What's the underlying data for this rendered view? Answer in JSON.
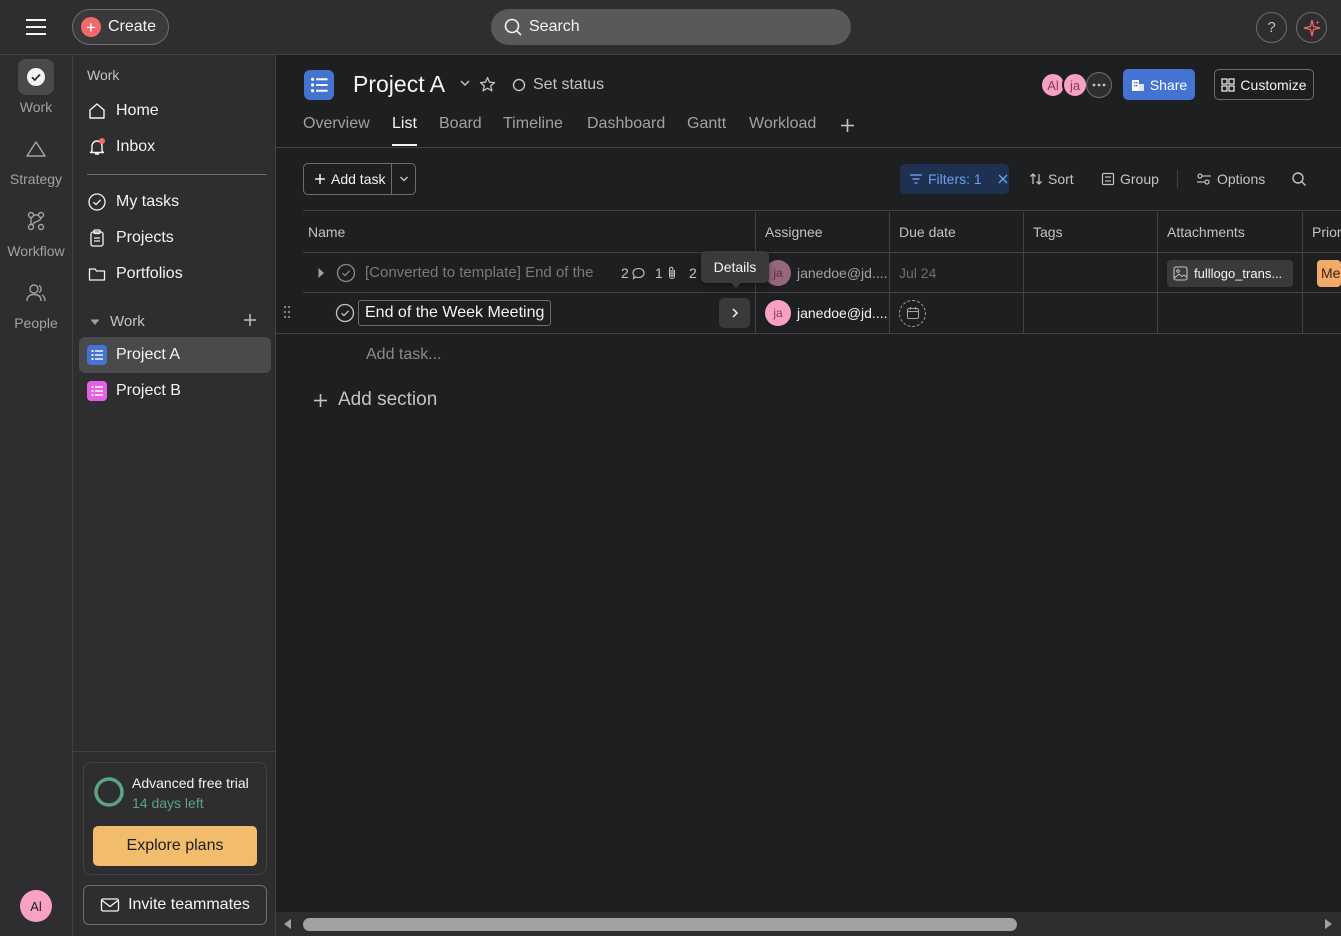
{
  "topbar": {
    "create_label": "Create",
    "search_placeholder": "Search",
    "help_label": "?"
  },
  "rail": {
    "items": [
      {
        "label": "Work",
        "icon": "check-circle-icon"
      },
      {
        "label": "Strategy",
        "icon": "triangle-icon"
      },
      {
        "label": "Workflow",
        "icon": "workflow-icon"
      },
      {
        "label": "People",
        "icon": "people-icon"
      }
    ],
    "avatar_initials": "Al"
  },
  "sidebar": {
    "section_title": "Work",
    "nav": [
      {
        "label": "Home",
        "icon": "home-icon"
      },
      {
        "label": "Inbox",
        "icon": "bell-icon"
      }
    ],
    "nav2": [
      {
        "label": "My tasks",
        "icon": "check-circle-icon"
      },
      {
        "label": "Projects",
        "icon": "clipboard-icon"
      },
      {
        "label": "Portfolios",
        "icon": "folder-icon"
      }
    ],
    "work_group": "Work",
    "projects": [
      {
        "label": "Project A",
        "color": "#4573d2",
        "active": true
      },
      {
        "label": "Project B",
        "color": "#e362e3",
        "active": false
      }
    ],
    "trial": {
      "title": "Advanced free trial",
      "subtitle": "14 days left",
      "cta": "Explore plans"
    },
    "invite_label": "Invite teammates"
  },
  "project": {
    "title": "Project A",
    "set_status": "Set status",
    "members": [
      "Al",
      "ja"
    ],
    "share_label": "Share",
    "customize_label": "Customize",
    "tabs": [
      "Overview",
      "List",
      "Board",
      "Timeline",
      "Dashboard",
      "Gantt",
      "Workload"
    ],
    "active_tab": "List"
  },
  "toolbar": {
    "add_task": "Add task",
    "filters": "Filters: 1",
    "sort": "Sort",
    "group": "Group",
    "options": "Options"
  },
  "table": {
    "columns": [
      "Name",
      "Assignee",
      "Due date",
      "Tags",
      "Attachments",
      "Prior"
    ],
    "rows": [
      {
        "name": "[Converted to template] End of the",
        "comments": "2",
        "attachments_count": "1",
        "subtasks": "2",
        "assignee_initials": "ja",
        "assignee": "janedoe@jd....",
        "due": "Jul 24",
        "attachment": "fulllogo_trans...",
        "priority": "Me",
        "dimmed": true
      },
      {
        "name": "End of the Week Meeting",
        "assignee_initials": "ja",
        "assignee": "janedoe@jd....",
        "due": "",
        "dimmed": false
      }
    ],
    "tooltip": "Details",
    "add_task_placeholder": "Add task...",
    "add_section": "Add section"
  },
  "colors": {
    "accent_blue": "#4573d2",
    "brand_coral": "#f06a6a",
    "trial_green": "#5da283",
    "explore_orange": "#f1bd6c",
    "priority_orange": "#f1a96c"
  }
}
